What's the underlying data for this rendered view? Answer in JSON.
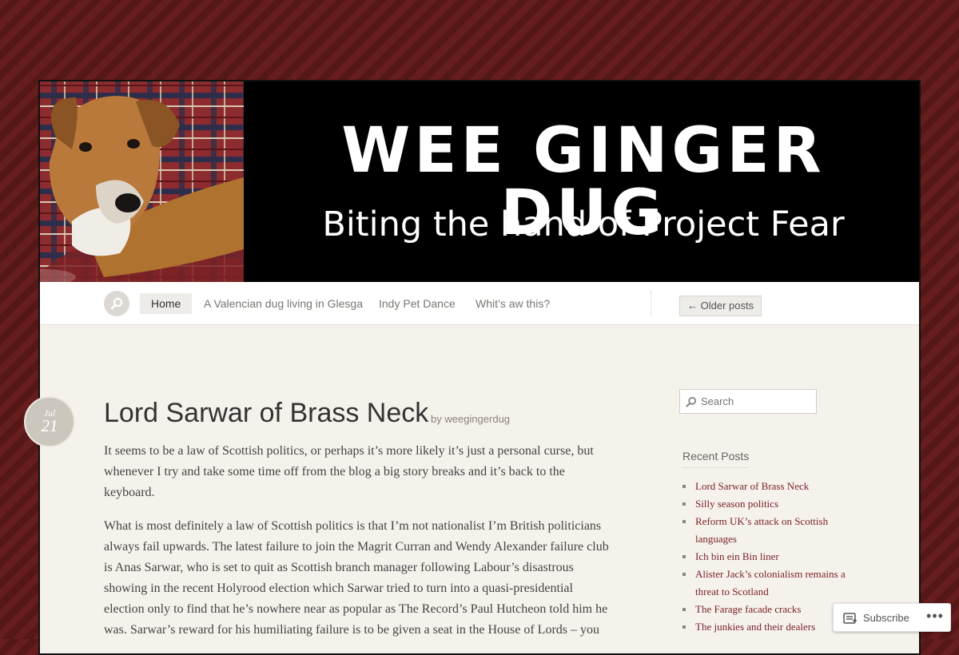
{
  "header": {
    "title": "WEE GINGER DUG",
    "tagline": "Biting the hand of Project Fear"
  },
  "nav": {
    "search_icon": "search-icon",
    "items": [
      {
        "label": "Home",
        "active": true
      },
      {
        "label": "A Valencian dug living in Glesga",
        "active": false
      },
      {
        "label": "Indy Pet Dance",
        "active": false
      },
      {
        "label": "Whit’s aw this?",
        "active": false
      }
    ],
    "older_posts_label": "← Older posts"
  },
  "post": {
    "date_month": "Jul",
    "date_day": "21",
    "title": "Lord Sarwar of Brass Neck",
    "byline_prefix": "by",
    "author": "weegingerdug",
    "paragraphs": [
      "It seems to be a law of Scottish politics, or perhaps it’s more likely it’s just a personal curse, but whenever I try and take some time off from the blog a big story breaks and it’s back to the keyboard.",
      "What is most definitely a law of Scottish politics is that I’m not nationalist I’m British politicians always fail upwards. The latest failure to join the Magrit Curran and Wendy Alexander failure club is Anas Sarwar, who is set to quit as Scottish branch manager following Labour’s disastrous showing in the recent Holyrood election which Sarwar tried to turn into a quasi-presidential election only to find that he’s nowhere near as popular as The Record’s Paul Hutcheon told him he was. Sarwar’s reward for his humiliating failure is to be given a seat in the House of Lords – you"
    ]
  },
  "sidebar": {
    "search_placeholder": "Search",
    "recent_posts_title": "Recent Posts",
    "recent_posts": [
      "Lord Sarwar of Brass Neck",
      "Silly season politics",
      "Reform UK’s attack on Scottish languages",
      "Ich bin ein Bin liner",
      "Alister Jack’s colonialism remains a threat to Scotland",
      "The Farage facade cracks",
      "The junkies and their dealers"
    ]
  },
  "subscribe": {
    "label": "Subscribe",
    "more_label": "•••"
  },
  "colors": {
    "background": "#5e1a1a",
    "link": "#7a1f24",
    "banner": "#000000"
  }
}
